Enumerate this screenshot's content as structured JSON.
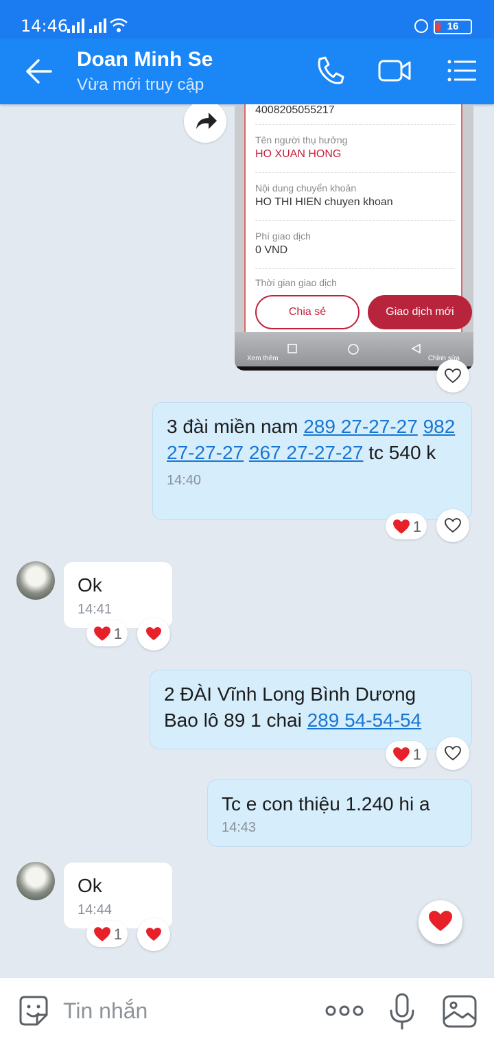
{
  "status": {
    "time": "14:46",
    "battery": "16"
  },
  "header": {
    "title": "Doan Minh Se",
    "subtitle": "Vừa mới truy cập"
  },
  "receipt": {
    "account_number": "4008205055217",
    "beneficiary_label": "Tên người thụ hưởng",
    "beneficiary_value": "HO XUAN HONG",
    "content_label": "Nội dung chuyển khoản",
    "content_value": "HO THI HIEN chuyen khoan",
    "fee_label": "Phí giao dịch",
    "fee_value": "0 VND",
    "time_label": "Thời gian giao dịch",
    "share_label": "Chia sẻ",
    "new_label": "Giao dịch mới",
    "more_label": "Xem thêm",
    "edit_label": "Chỉnh sửa"
  },
  "messages": [
    {
      "text_a": "3 đài miền nam ",
      "link_a": "289 27-27-27",
      "link_b": "982 27-27-27",
      "link_c": "267 27-27-27",
      "text_b": " tc",
      "text_c": "540 k",
      "time": "14:40",
      "reaction_count": "1"
    },
    {
      "text": "Ok",
      "time": "14:41",
      "reaction_count": "1"
    },
    {
      "line1": "2 ĐÀI Vĩnh Long Bình Dương",
      "line2": "Bao lô 89 1 chai ",
      "link": "289 54-54-54",
      "reaction_count": "1"
    },
    {
      "text": "Tc e con thiệu 1.240 hi a",
      "time": "14:43"
    },
    {
      "text": "Ok",
      "time": "14:44",
      "reaction_count": "1"
    }
  ],
  "input": {
    "placeholder": "Tin nhắn"
  },
  "colors": {
    "header": "#1b86f5",
    "bubble_out": "#d6edfc",
    "heart": "#e8202a",
    "link": "#1776d2"
  }
}
